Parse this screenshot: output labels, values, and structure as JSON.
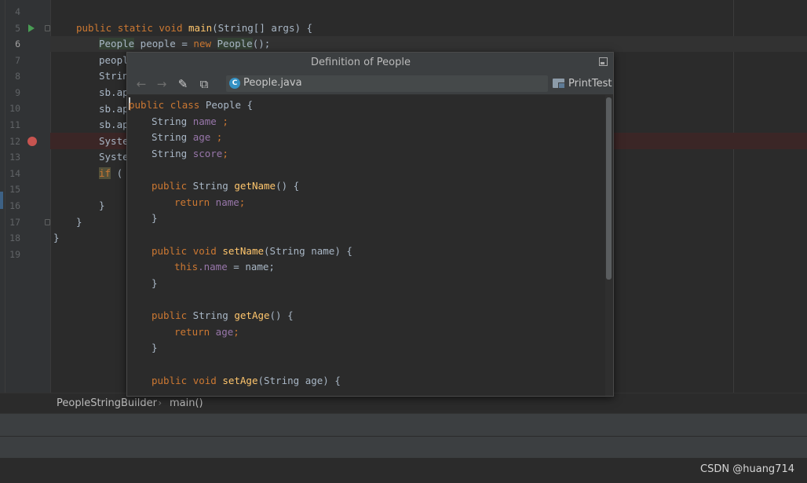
{
  "editor": {
    "line_numbers": [
      "4",
      "5",
      "6",
      "7",
      "8",
      "9",
      "10",
      "11",
      "12",
      "13",
      "14",
      "15",
      "16",
      "17",
      "18",
      "19"
    ],
    "main_signature": {
      "kw1": "public",
      "kw2": "static",
      "kw3": "void",
      "fn": "main",
      "rest": "(String[] args) {"
    },
    "line6": {
      "type1": "People",
      "mid": " people = ",
      "kw": "new",
      "type2": "People",
      "end": "();"
    },
    "partial_lines": [
      "peopl",
      "Strin",
      "sb.ap",
      "sb.ap",
      "sb.ap",
      "Syste",
      "Syste"
    ],
    "if_line": {
      "kw": "if",
      "rest": " ("
    },
    "close_brace": "}"
  },
  "popup": {
    "title": "Definition of People",
    "file_badge": "C",
    "file_name": "People.java",
    "module_name": "PrintTest",
    "icons": {
      "back": "back-arrow-icon",
      "forward": "forward-arrow-icon",
      "edit": "edit-source-icon",
      "find": "find-usages-icon",
      "pin": "pin-window-icon"
    },
    "code": {
      "class_decl": {
        "kw1": "public",
        "kw2": "class",
        "rest": " People {"
      },
      "field_name": {
        "code": "String ",
        "fld": "name",
        "end": " ;"
      },
      "field_age": {
        "code": "String ",
        "fld": "age",
        "end": " ;"
      },
      "field_score": {
        "code": "String ",
        "fld": "score",
        "end": ";"
      },
      "getName": {
        "kw": "public",
        "rest1": " String ",
        "fn": "getName",
        "rest2": "() {"
      },
      "return_name": {
        "kw": "return",
        "fld": " name",
        "end": ";"
      },
      "setName": {
        "kw1": "public",
        "kw2": "void",
        "fn": "setName",
        "rest": "(String name) {"
      },
      "this_name": {
        "kw": "this",
        "fld": ".name",
        "rest": " = name;"
      },
      "getAge": {
        "kw": "public",
        "rest1": " String ",
        "fn": "getAge",
        "rest2": "() {"
      },
      "return_age": {
        "kw": "return",
        "fld": " age",
        "end": ";"
      },
      "setAge": {
        "kw1": "public",
        "kw2": "void",
        "fn": "setAge",
        "rest": "(String age) {"
      },
      "brace": "}"
    }
  },
  "breadcrumb": {
    "class": "PeopleStringBuilder",
    "method": "main()"
  },
  "watermark": "CSDN @huang714",
  "colors": {
    "keyword": "#cc7832",
    "method": "#ffc66d",
    "field": "#9876aa",
    "text": "#a9b7c6",
    "breakpoint": "#c75450"
  }
}
